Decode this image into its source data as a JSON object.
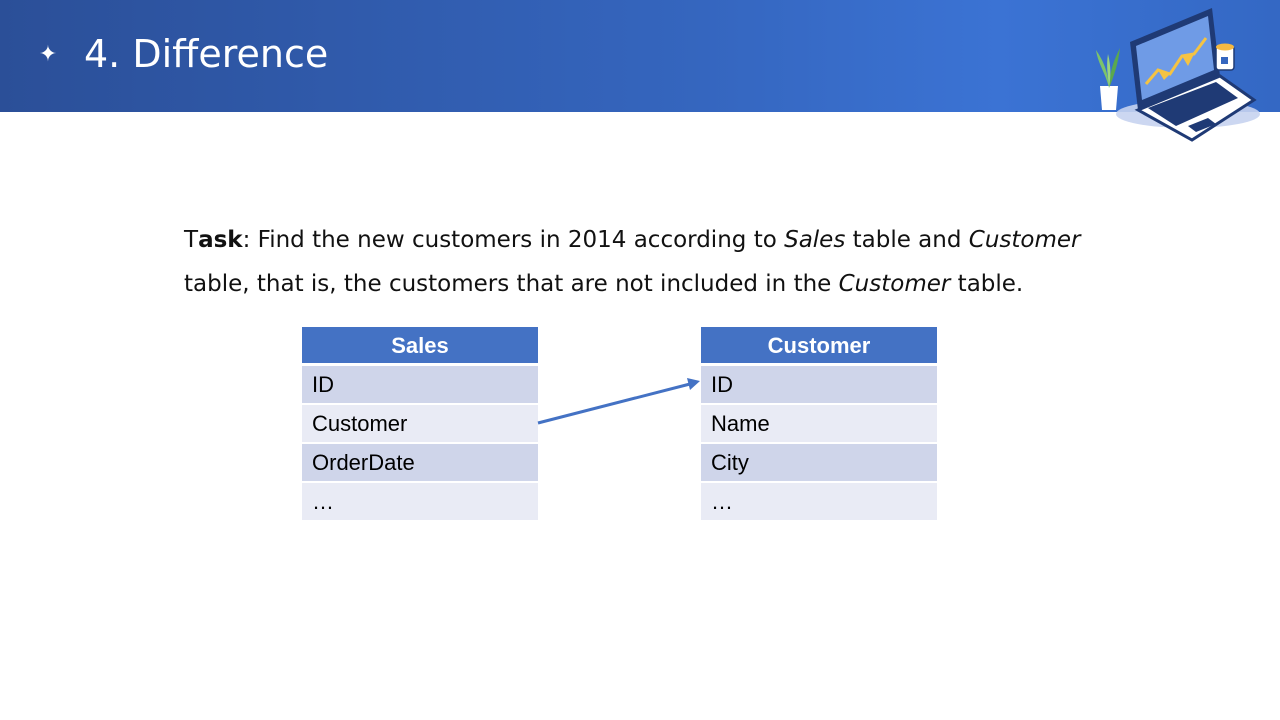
{
  "header": {
    "title": "4. Difference",
    "bullet_icon": "four-point-star-icon",
    "illustration_icon": "laptop-desk-illustration"
  },
  "task": {
    "label_first": "T",
    "label_rest": "ask",
    "seg1": ": Find the new customers in 2014 according to ",
    "sales_word": "Sales",
    "seg2": " table and ",
    "customer_word": "Customer",
    "seg3": " table, that is, the customers that are not included in the ",
    "customer_word2": "Customer",
    "seg4": " table."
  },
  "sales_table": {
    "header": "Sales",
    "rows": [
      "ID",
      "Customer",
      "OrderDate",
      "…"
    ]
  },
  "customer_table": {
    "header": "Customer",
    "rows": [
      "ID",
      "Name",
      "City",
      "…"
    ]
  },
  "colors": {
    "header_bar": "#2b4f98",
    "table_header": "#4472c4",
    "row_odd": "#cfd5ea",
    "row_even": "#e9ebf5",
    "arrow": "#4472c4"
  }
}
